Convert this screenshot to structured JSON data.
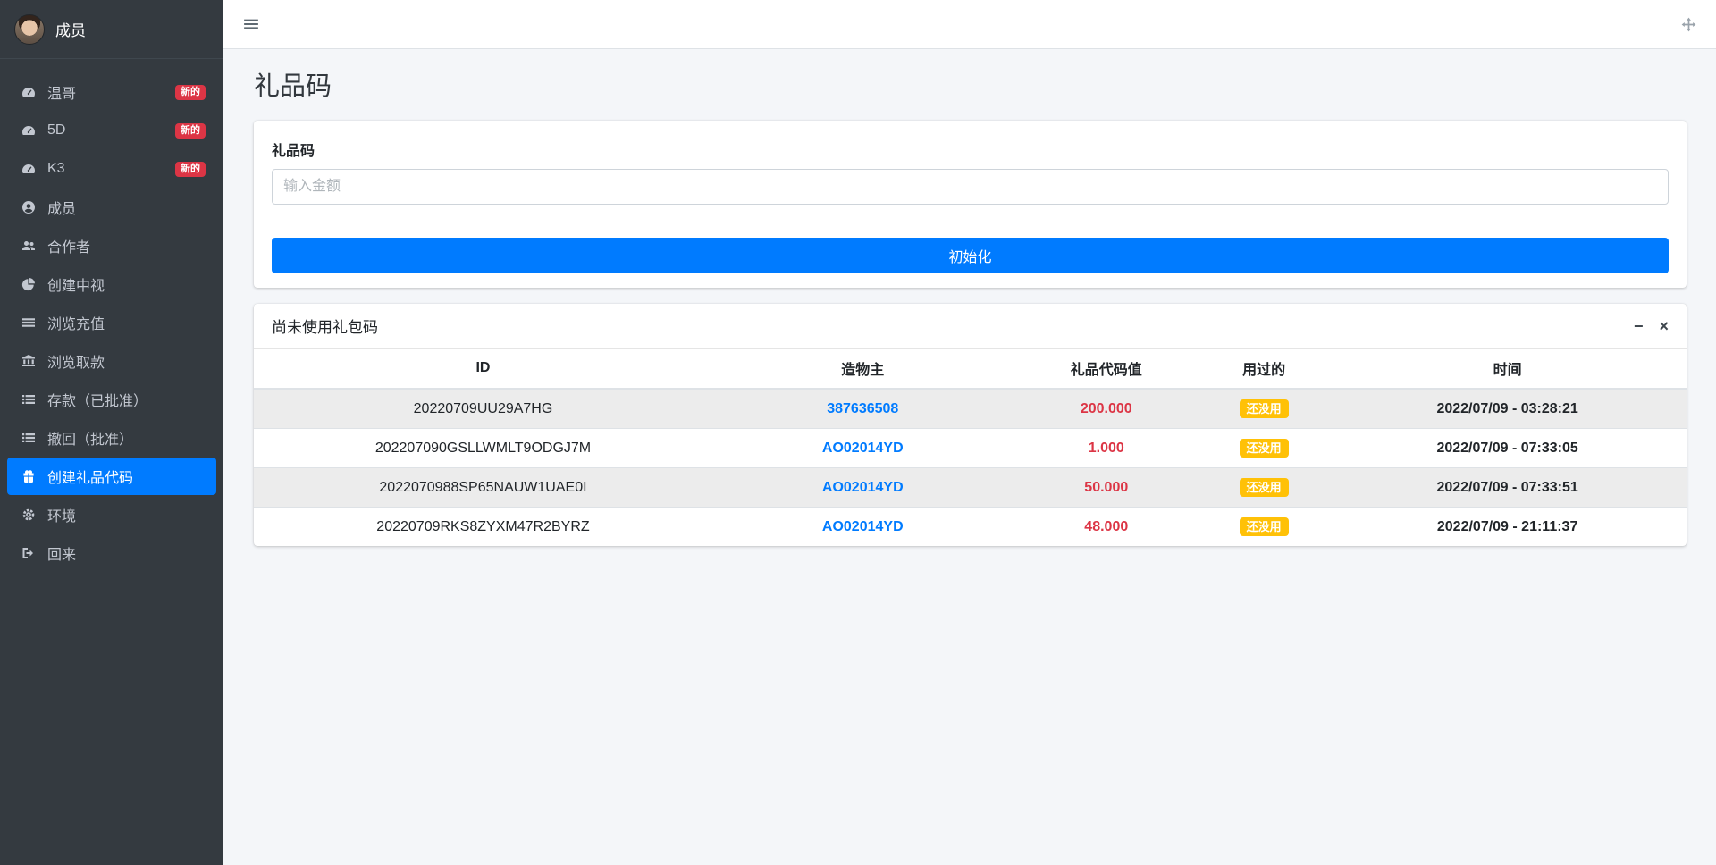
{
  "sidebar": {
    "brand": "成员",
    "items": [
      {
        "label": "温哥",
        "icon": "speedometer-icon",
        "badge": "新的"
      },
      {
        "label": "5D",
        "icon": "speedometer-icon",
        "badge": "新的"
      },
      {
        "label": "K3",
        "icon": "speedometer-icon",
        "badge": "新的"
      },
      {
        "label": "成员",
        "icon": "user-icon"
      },
      {
        "label": "合作者",
        "icon": "users-icon"
      },
      {
        "label": "创建中视",
        "icon": "pie-chart-icon"
      },
      {
        "label": "浏览充值",
        "icon": "bars-icon"
      },
      {
        "label": "浏览取款",
        "icon": "bank-icon"
      },
      {
        "label": "存款（已批准）",
        "icon": "list-icon"
      },
      {
        "label": "撤回（批准）",
        "icon": "list-icon"
      },
      {
        "label": "创建礼品代码",
        "icon": "gift-icon",
        "active": true
      },
      {
        "label": "环境",
        "icon": "gear-icon"
      },
      {
        "label": "回来",
        "icon": "signout-icon"
      }
    ]
  },
  "topbar": {
    "menu_icon": "hamburger-icon",
    "fullscreen_icon": "expand-arrows-icon"
  },
  "page": {
    "title": "礼品码"
  },
  "form_card": {
    "label": "礼品码",
    "input_value": "",
    "input_placeholder": "输入金额",
    "submit_label": "初始化"
  },
  "table_card": {
    "title": "尚未使用礼包码",
    "tools": {
      "minimize": "−",
      "close": "×"
    },
    "columns": [
      "ID",
      "造物主",
      "礼品代码值",
      "用过的",
      "时间"
    ],
    "rows": [
      {
        "id": "20220709UU29A7HG",
        "creator": "387636508",
        "value": "200.000",
        "used": "还没用",
        "time": "2022/07/09 - 03:28:21"
      },
      {
        "id": "202207090GSLLWMLT9ODGJ7M",
        "creator": "AO02014YD",
        "value": "1.000",
        "used": "还没用",
        "time": "2022/07/09 - 07:33:05"
      },
      {
        "id": "2022070988SP65NAUW1UAE0I",
        "creator": "AO02014YD",
        "value": "50.000",
        "used": "还没用",
        "time": "2022/07/09 - 07:33:51"
      },
      {
        "id": "20220709RKS8ZYXM47R2BYRZ",
        "creator": "AO02014YD",
        "value": "48.000",
        "used": "还没用",
        "time": "2022/07/09 - 21:11:37"
      }
    ]
  },
  "colors": {
    "accent": "#007bff",
    "danger": "#dc3545",
    "warning": "#ffc107",
    "sidebar_bg": "#343a40",
    "content_bg": "#f4f6f9"
  }
}
